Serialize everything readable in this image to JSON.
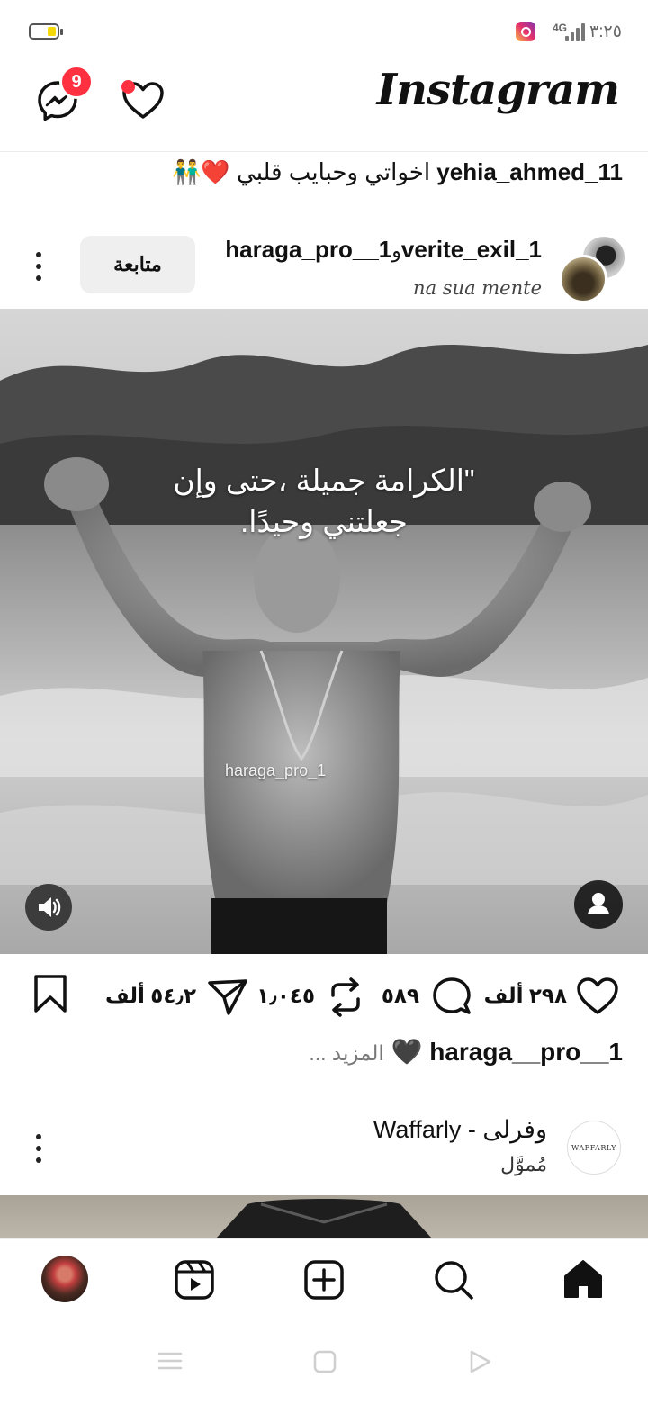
{
  "status_bar": {
    "time": "٣:٢٥",
    "network": "4G",
    "battery_color": "#f5d90a"
  },
  "header": {
    "brand": "Instagram",
    "messenger_badge": "9",
    "accent": "#ff3040"
  },
  "shared_caption": {
    "username": "yehia_ahmed_11",
    "text": "اخواتي وحبايب قلبي ❤️👬"
  },
  "post": {
    "authors": "haraga_pro__1",
    "connector": "و",
    "co_author": "verite_exil_1",
    "audio": "na sua mente",
    "follow_label": "متابعة",
    "overlay_quote": "\"الكرامة جميلة ،حتى وإن جعلتني وحيدًا.",
    "watermark": "haraga_pro_1",
    "likes": "٢٩٨ ألف",
    "comments": "٥٨٩",
    "reposts": "١٫٠٤٥",
    "shares": "٥٤٫٢ ألف",
    "caption_user": "haraga__pro__1",
    "caption_emoji": "🖤",
    "caption_more": "... المزيد"
  },
  "sponsored": {
    "name": "وفرلى - Waffarly",
    "label": "مُموَّل",
    "logo_text": "WAFFARLY"
  },
  "icons": {
    "messenger": "messenger-icon",
    "heart": "heart-icon",
    "like": "like-icon",
    "comment": "comment-icon",
    "repost": "repost-icon",
    "share": "send-icon",
    "save": "bookmark-icon",
    "home": "home-icon",
    "search": "search-icon",
    "create": "plus-square-icon",
    "reels": "reels-icon"
  }
}
